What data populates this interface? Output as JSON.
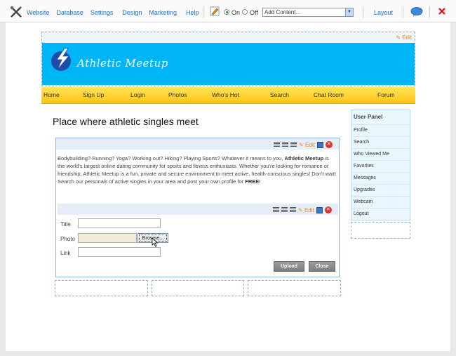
{
  "toolbar": {
    "menu": [
      "Website",
      "Database",
      "Settings",
      "Design",
      "Marketing",
      "Help"
    ],
    "on_label": "On",
    "off_label": "Off",
    "add_content": "Add Content...",
    "layout": "Layout"
  },
  "header": {
    "edit": "Edit",
    "site_title": "Athletic Meetup"
  },
  "nav": [
    "Home",
    "Sign Up",
    "Login",
    "Photos",
    "Who's Hot",
    "Search",
    "Chat Room",
    "Forum"
  ],
  "main": {
    "headline": "Place where athletic singles meet",
    "edit": "Edit",
    "body_1": "Bodybuilding? Running? Yoga? Working out? Hiking? Playing Sports? Whatever it means to you, ",
    "body_bold_1": "Athletic Meetup",
    "body_2": " is the world's largest online dating community for sports and fitness enthusiasts. Whether you're looking for romance or friendship, Athletic Meetup is a fun, private and secure environment to meet active, health-conscious singles! Don't wait! Search our personals of active singles in your area and post your own profile for ",
    "body_bold_2": "FREE",
    "body_3": "!"
  },
  "form": {
    "edit": "Edit",
    "title_label": "Title",
    "photo_label": "Photo",
    "link_label": "Link",
    "browse": "Browse...",
    "upload": "Upload",
    "close": "Close"
  },
  "user_panel": {
    "title": "User Panel",
    "items": [
      "Profile",
      "Search",
      "Who Viewed Me",
      "Favorites",
      "Messages",
      "Upgrades",
      "Webcam",
      "Logout"
    ]
  },
  "colors": {
    "banner": "#00b5f5",
    "nav": "#ffd21f",
    "link": "#2a6fbd",
    "edit": "#e88a1a"
  }
}
